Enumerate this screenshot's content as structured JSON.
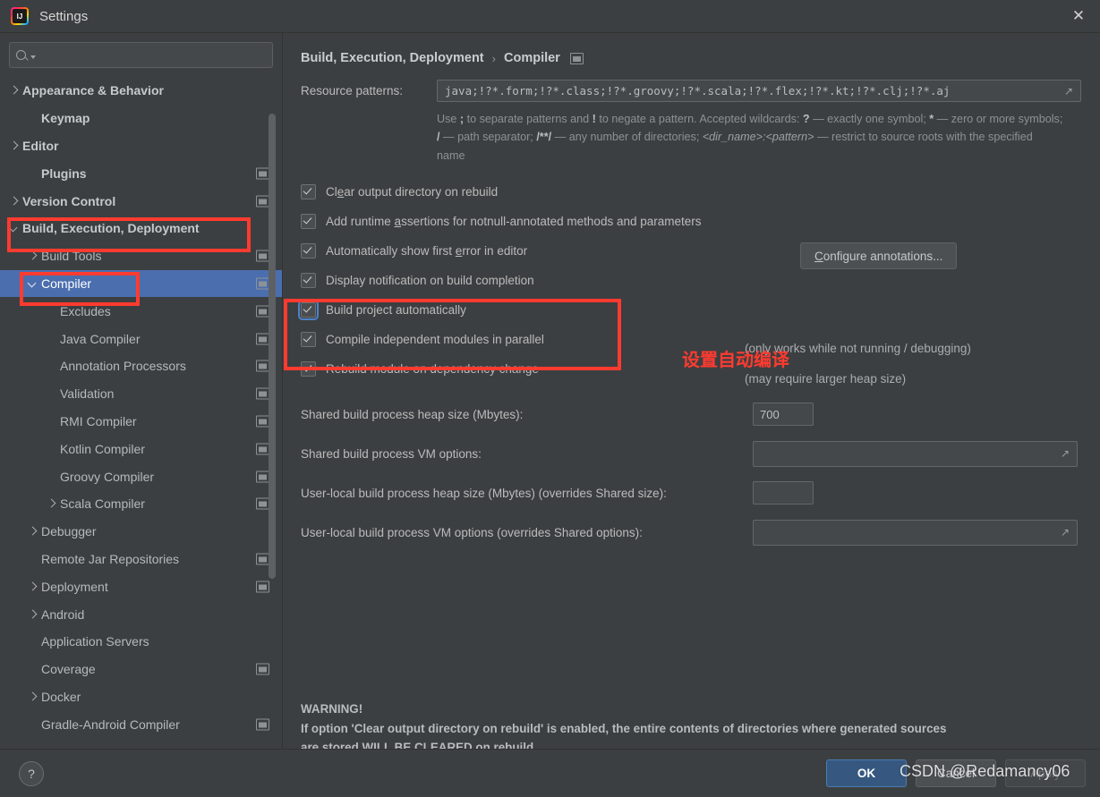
{
  "window": {
    "title": "Settings",
    "logo_icon": "intellij-idea-logo-icon",
    "close_icon": "close-icon"
  },
  "sidebar": {
    "search": {
      "placeholder": "",
      "value": "",
      "icon": "search-icon"
    },
    "items": [
      {
        "label": "Appearance & Behavior",
        "arrow": "right",
        "indent": 1,
        "bold": true,
        "project_icon": false,
        "selected": false
      },
      {
        "label": "Keymap",
        "arrow": "none",
        "indent": 2,
        "bold": true,
        "project_icon": false,
        "selected": false
      },
      {
        "label": "Editor",
        "arrow": "right",
        "indent": 1,
        "bold": true,
        "project_icon": false,
        "selected": false
      },
      {
        "label": "Plugins",
        "arrow": "none",
        "indent": 2,
        "bold": true,
        "project_icon": true,
        "selected": false
      },
      {
        "label": "Version Control",
        "arrow": "right",
        "indent": 1,
        "bold": true,
        "project_icon": true,
        "selected": false
      },
      {
        "label": "Build, Execution, Deployment",
        "arrow": "down",
        "indent": 1,
        "bold": true,
        "project_icon": false,
        "selected": false
      },
      {
        "label": "Build Tools",
        "arrow": "right",
        "indent": 2,
        "bold": false,
        "project_icon": true,
        "selected": false
      },
      {
        "label": "Compiler",
        "arrow": "down",
        "indent": 2,
        "bold": false,
        "project_icon": true,
        "selected": true
      },
      {
        "label": "Excludes",
        "arrow": "none",
        "indent": 3,
        "bold": false,
        "project_icon": true,
        "selected": false
      },
      {
        "label": "Java Compiler",
        "arrow": "none",
        "indent": 3,
        "bold": false,
        "project_icon": true,
        "selected": false
      },
      {
        "label": "Annotation Processors",
        "arrow": "none",
        "indent": 3,
        "bold": false,
        "project_icon": true,
        "selected": false
      },
      {
        "label": "Validation",
        "arrow": "none",
        "indent": 3,
        "bold": false,
        "project_icon": true,
        "selected": false
      },
      {
        "label": "RMI Compiler",
        "arrow": "none",
        "indent": 3,
        "bold": false,
        "project_icon": true,
        "selected": false
      },
      {
        "label": "Kotlin Compiler",
        "arrow": "none",
        "indent": 3,
        "bold": false,
        "project_icon": true,
        "selected": false
      },
      {
        "label": "Groovy Compiler",
        "arrow": "none",
        "indent": 3,
        "bold": false,
        "project_icon": true,
        "selected": false
      },
      {
        "label": "Scala Compiler",
        "arrow": "right",
        "indent": 3,
        "bold": false,
        "project_icon": true,
        "selected": false
      },
      {
        "label": "Debugger",
        "arrow": "right",
        "indent": 2,
        "bold": false,
        "project_icon": false,
        "selected": false
      },
      {
        "label": "Remote Jar Repositories",
        "arrow": "none",
        "indent": 2,
        "bold": false,
        "project_icon": true,
        "selected": false
      },
      {
        "label": "Deployment",
        "arrow": "right",
        "indent": 2,
        "bold": false,
        "project_icon": true,
        "selected": false
      },
      {
        "label": "Android",
        "arrow": "right",
        "indent": 2,
        "bold": false,
        "project_icon": false,
        "selected": false
      },
      {
        "label": "Application Servers",
        "arrow": "none",
        "indent": 2,
        "bold": false,
        "project_icon": false,
        "selected": false
      },
      {
        "label": "Coverage",
        "arrow": "none",
        "indent": 2,
        "bold": false,
        "project_icon": true,
        "selected": false
      },
      {
        "label": "Docker",
        "arrow": "right",
        "indent": 2,
        "bold": false,
        "project_icon": false,
        "selected": false
      },
      {
        "label": "Gradle-Android Compiler",
        "arrow": "none",
        "indent": 2,
        "bold": false,
        "project_icon": true,
        "selected": false
      }
    ]
  },
  "panel": {
    "breadcrumb": {
      "root": "Build, Execution, Deployment",
      "separator": "›",
      "leaf": "Compiler",
      "project_icon": "project-scope-icon"
    },
    "nav": {
      "back_icon": "arrow-left-icon",
      "forward_icon": "arrow-right-icon"
    },
    "resource_patterns": {
      "label": "Resource patterns:",
      "value": "java;!?*.form;!?*.class;!?*.groovy;!?*.scala;!?*.flex;!?*.kt;!?*.clj;!?*.aj",
      "expand_icon": "expand-field-icon"
    },
    "hint_line1_a": "Use ",
    "hint_semicolon": ";",
    "hint_line1_b": " to separate patterns and ",
    "hint_bang": "!",
    "hint_line1_c": " to negate a pattern. Accepted wildcards: ",
    "hint_q": "?",
    "hint_line1_d": " — exactly one symbol; ",
    "hint_star": "*",
    "hint_line1_e": " — zero or more symbols; ",
    "hint_slash": "/",
    "hint_line2_a": " — path separator; ",
    "hint_globstar": "/**/",
    "hint_line2_b": " — any number of directories; ",
    "hint_dirname": "<dir_name>:<pattern>",
    "hint_line2_c": " — restrict to source roots with the specified name",
    "checkboxes": [
      {
        "label_pre": "Cl",
        "mnemonic": "e",
        "label_post": "ar output directory on rebuild",
        "checked": true,
        "focused": false
      },
      {
        "label_pre": "Add runtime ",
        "mnemonic": "a",
        "label_post": "ssertions for notnull-annotated methods and parameters",
        "checked": true,
        "focused": false
      },
      {
        "label_pre": "Automatically show first ",
        "mnemonic": "e",
        "label_post": "rror in editor",
        "checked": true,
        "focused": false
      },
      {
        "label_pre": "Display notification on build completion",
        "mnemonic": "",
        "label_post": "",
        "checked": true,
        "focused": false
      },
      {
        "label_pre": "Build project automatically",
        "mnemonic": "",
        "label_post": "",
        "checked": true,
        "focused": true
      },
      {
        "label_pre": "Compile independent modules in parallel",
        "mnemonic": "",
        "label_post": "",
        "checked": true,
        "focused": false
      },
      {
        "label_pre": "Rebuild module on dependency change",
        "mnemonic": "",
        "label_post": "",
        "checked": true,
        "focused": false
      }
    ],
    "configure_annotations": {
      "pre": "",
      "mnemonic": "C",
      "post": "onfigure annotations..."
    },
    "hint_not_running": "(only works while not running / debugging)",
    "hint_heap_size": "(may require larger heap size)",
    "heap_rows": [
      {
        "label": "Shared build process heap size (Mbytes):",
        "value": "700",
        "type": "small"
      },
      {
        "label": "Shared build process VM options:",
        "value": "",
        "type": "wide"
      },
      {
        "label": "User-local build process heap size (Mbytes) (overrides Shared size):",
        "value": "",
        "type": "small"
      },
      {
        "label": "User-local build process VM options (overrides Shared options):",
        "value": "",
        "type": "wide"
      }
    ],
    "warning": {
      "title": "WARNING!",
      "line1": "If option 'Clear output directory on rebuild' is enabled, the entire contents of directories where generated sources",
      "line2": "are stored WILL BE CLEARED on rebuild."
    }
  },
  "footer": {
    "help_label": "?",
    "ok_label": "OK",
    "cancel_label": "Cancel",
    "apply_label": "Apply"
  },
  "annotations": {
    "chinese_note": "设置自动编译",
    "watermark": "CSDN @Redamancy06",
    "box_color": "#ff3b30"
  }
}
